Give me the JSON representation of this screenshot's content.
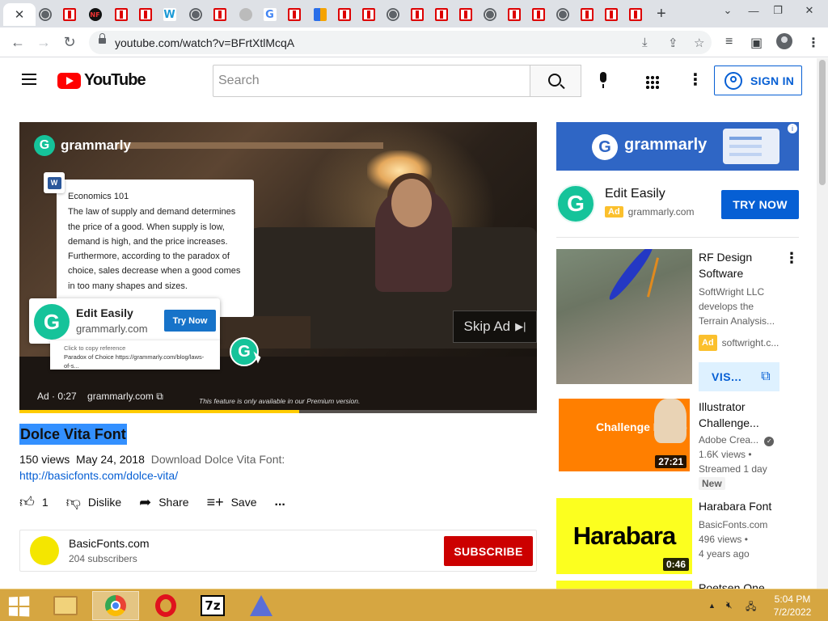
{
  "browser": {
    "active_tab_close": "✕",
    "new_tab": "+",
    "url": "youtube.com/watch?v=BFrtXtlMcqA",
    "window_controls": [
      "⌄",
      "—",
      "❐",
      "✕"
    ]
  },
  "youtube": {
    "logo_text": "YouTube",
    "search_placeholder": "Search",
    "sign_in": "SIGN IN"
  },
  "player": {
    "brand": "grammarly",
    "doc_title": "Economics 101",
    "doc_body": "The law of supply and demand determines the price of a good. When supply is low, demand is high, and the price increases. Furthermore, according to the paradox of choice, sales decrease when a good comes in too many shapes and sizes.",
    "edit_title": "Edit Easily",
    "edit_domain": "grammarly.com",
    "try_now": "Try Now",
    "copy_ref_label": "Click to copy reference",
    "copy_ref_text": "Paradox of Choice https://grammarly.com/blog/laws-of-s...",
    "skip_ad": "Skip Ad",
    "ad_time": "Ad · 0:27",
    "ad_domain": "grammarly.com",
    "premium_note": "This feature is only available in our Premium version.",
    "progress": 0.54
  },
  "video": {
    "title": "Dolce Vita Font",
    "views": "150 views",
    "date": "May 24, 2018",
    "description": "Download Dolce Vita Font:",
    "link": "http://basicfonts.com/dolce-vita/",
    "likes": "1",
    "dislike": "Dislike",
    "share": "Share",
    "save": "Save",
    "more": "..."
  },
  "channel": {
    "name": "BasicFonts.com",
    "subscribers": "204 subscribers",
    "subscribe": "SUBSCRIBE"
  },
  "sidebar": {
    "banner_brand": "grammarly",
    "ad_title": "Edit Easily",
    "ad_badge": "Ad",
    "ad_domain": "grammarly.com",
    "ad_cta": "TRY NOW",
    "cards": [
      {
        "title": "RF Design Software",
        "line1": "SoftWright LLC",
        "line2": "develops the",
        "line3": "Terrain Analysis...",
        "badge": "Ad",
        "domain": "softwright.c...",
        "cta": "VIS..."
      },
      {
        "title": "Illustrator Challenge...",
        "channel": "Adobe Crea...",
        "views": "1.6K views •",
        "streamed": "Streamed 1 day",
        "new": "New",
        "duration": "27:21",
        "thumb_text": "Challenge Recap"
      },
      {
        "title": "Harabara Font",
        "channel": "BasicFonts.com",
        "views": "496 views •",
        "age": "4 years ago",
        "duration": "0:46",
        "thumb_text": "Harabara"
      },
      {
        "title": "Poetsen One"
      }
    ]
  },
  "taskbar": {
    "apps": [
      "file-explorer",
      "chrome",
      "opera",
      "7zip",
      "app"
    ],
    "seven_zip_label": "7z",
    "time": "5:04 PM",
    "date": "7/2/2022"
  },
  "colors": {
    "youtube_red": "#ff0000",
    "grammarly_green": "#15c39a",
    "link_blue": "#065fd4",
    "taskbar": "#d6a641"
  }
}
